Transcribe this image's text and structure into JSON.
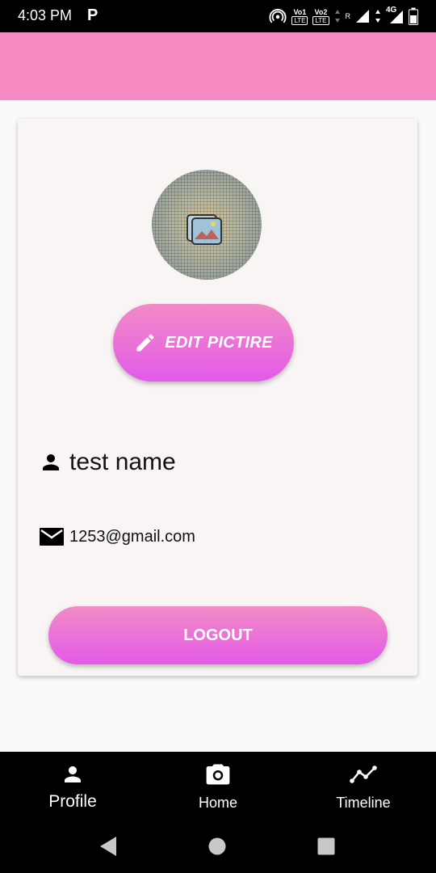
{
  "status_bar": {
    "time": "4:03 PM",
    "notification_icon": "P",
    "volte1": "Vo1",
    "volte1_sub": "LTE",
    "volte2": "Vo2",
    "volte2_sub": "LTE",
    "roaming": "R",
    "network": "4G",
    "icons": [
      "hotspot-icon",
      "signal-icon",
      "battery-icon"
    ]
  },
  "profile": {
    "avatar_icon": "image-icon",
    "edit_picture_label": "EDIT PICTIRE",
    "name": "test name",
    "email": "1253@gmail.com",
    "logout_label": "LOGOUT"
  },
  "bottom_nav": {
    "items": [
      {
        "label": "Profile",
        "icon": "person-icon"
      },
      {
        "label": "Home",
        "icon": "camera-icon"
      },
      {
        "label": "Timeline",
        "icon": "timeline-icon"
      }
    ]
  },
  "system_nav": {
    "icons": [
      "back-icon",
      "home-circle-icon",
      "recents-icon"
    ]
  },
  "colors": {
    "app_bar": "#f48ac1",
    "button_gradient_top": "#f28bc6",
    "button_gradient_bottom": "#e35ae8",
    "card_background": "#f9f5f5",
    "nav_background": "#000000"
  }
}
